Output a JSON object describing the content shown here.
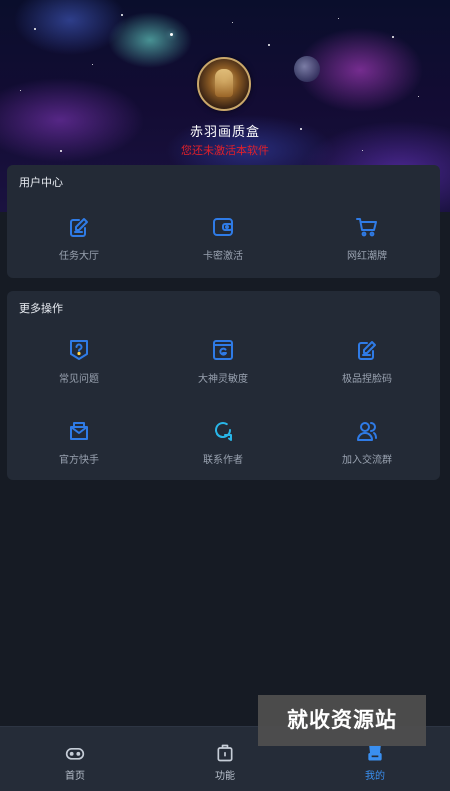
{
  "profile": {
    "username": "赤羽画质盒",
    "status": "您还未激活本软件"
  },
  "user_center": {
    "title": "用户中心",
    "items": [
      {
        "label": "任务大厅",
        "icon": "task-edit-icon"
      },
      {
        "label": "卡密激活",
        "icon": "wallet-card-icon"
      },
      {
        "label": "网红潮牌",
        "icon": "shopping-cart-icon"
      }
    ]
  },
  "more_actions": {
    "title": "更多操作",
    "items": [
      {
        "label": "常见问题",
        "icon": "question-shield-icon"
      },
      {
        "label": "大神灵敏度",
        "icon": "g-window-icon"
      },
      {
        "label": "极品捏脸码",
        "icon": "edit-doc-icon"
      },
      {
        "label": "官方快手",
        "icon": "mail-icon"
      },
      {
        "label": "联系作者",
        "icon": "chat-bubble-icon"
      },
      {
        "label": "加入交流群",
        "icon": "group-users-icon"
      }
    ]
  },
  "bottom_nav": {
    "items": [
      {
        "label": "首页",
        "icon": "gamepad-icon"
      },
      {
        "label": "功能",
        "icon": "toolbox-icon"
      },
      {
        "label": "我的",
        "icon": "profile-icon"
      }
    ]
  },
  "watermark": {
    "text": "就收资源站"
  },
  "colors": {
    "accent": "#3a8ff0",
    "icon": "#2f7be6",
    "icon_cyan": "#29b6e8",
    "status_red": "#e0202a",
    "card_bg": "#232a36",
    "page_bg": "#161b24"
  }
}
